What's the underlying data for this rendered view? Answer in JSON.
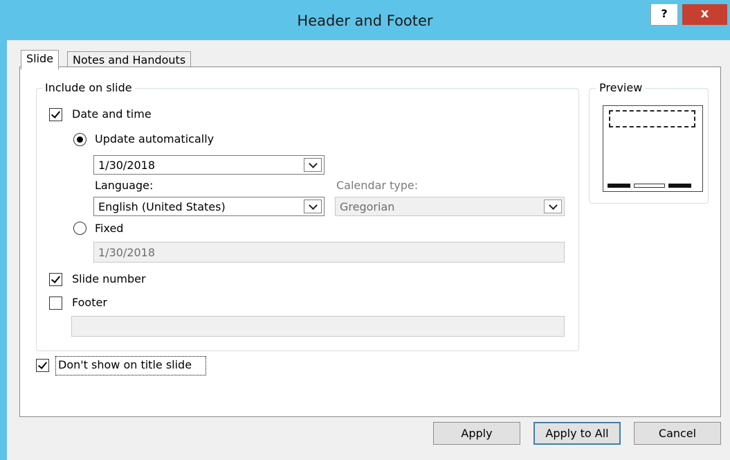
{
  "window": {
    "title": "Header and Footer",
    "help_label": "?",
    "close_label": "x"
  },
  "tabs": [
    {
      "label": "Slide",
      "active": true
    },
    {
      "label": "Notes and Handouts",
      "active": false
    }
  ],
  "include_group": {
    "legend": "Include on slide",
    "date_time": {
      "label": "Date and time",
      "checked": true,
      "update_auto": {
        "label": "Update automatically",
        "selected": true,
        "value": "1/30/2018"
      },
      "language": {
        "label": "Language:",
        "value": "English (United States)"
      },
      "calendar": {
        "label": "Calendar type:",
        "value": "Gregorian",
        "disabled": true
      },
      "fixed": {
        "label": "Fixed",
        "selected": false,
        "value": "1/30/2018"
      }
    },
    "slide_number": {
      "label": "Slide number",
      "checked": true
    },
    "footer": {
      "label": "Footer",
      "checked": false,
      "value": ""
    }
  },
  "dont_show_title": {
    "label": "Don't show on title slide",
    "checked": true
  },
  "preview": {
    "legend": "Preview"
  },
  "buttons": {
    "apply": "Apply",
    "apply_all": "Apply to All",
    "cancel": "Cancel"
  },
  "colors": {
    "titlebar": "#5ec3e8",
    "close_button": "#c7402f",
    "default_button_border": "#3c7fb1"
  }
}
